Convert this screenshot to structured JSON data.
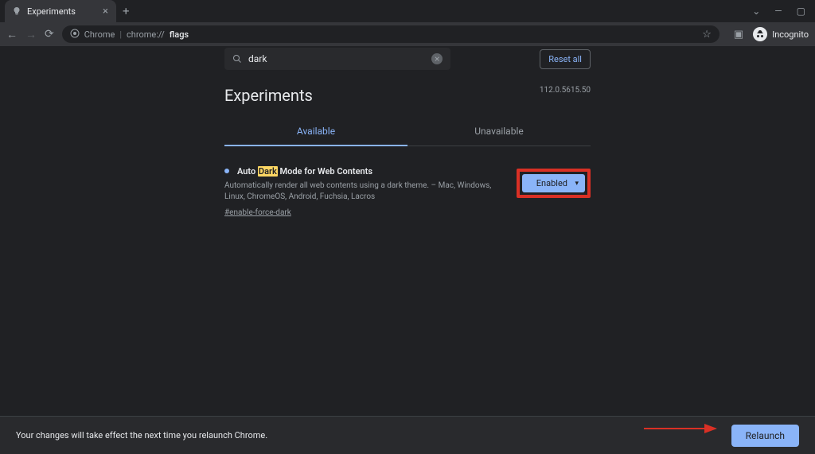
{
  "titlebar": {
    "tab_title": "Experiments",
    "incognito_label": "Incognito"
  },
  "toolbar": {
    "url_prefix": "Chrome",
    "url_path": "chrome://",
    "url_highlight": "flags"
  },
  "flags_page": {
    "search_value": "dark",
    "reset_all": "Reset all",
    "title": "Experiments",
    "version": "112.0.5615.50",
    "tabs": {
      "available": "Available",
      "unavailable": "Unavailable"
    },
    "flag": {
      "title_pre": "Auto ",
      "title_highlight": "Dark",
      "title_post": " Mode for Web Contents",
      "description": "Automatically render all web contents using a dark theme. – Mac, Windows, Linux, ChromeOS, Android, Fuchsia, Lacros",
      "tag": "#enable-force-dark",
      "select_value": "Enabled"
    }
  },
  "bottom_bar": {
    "message": "Your changes will take effect the next time you relaunch Chrome.",
    "relaunch": "Relaunch"
  }
}
